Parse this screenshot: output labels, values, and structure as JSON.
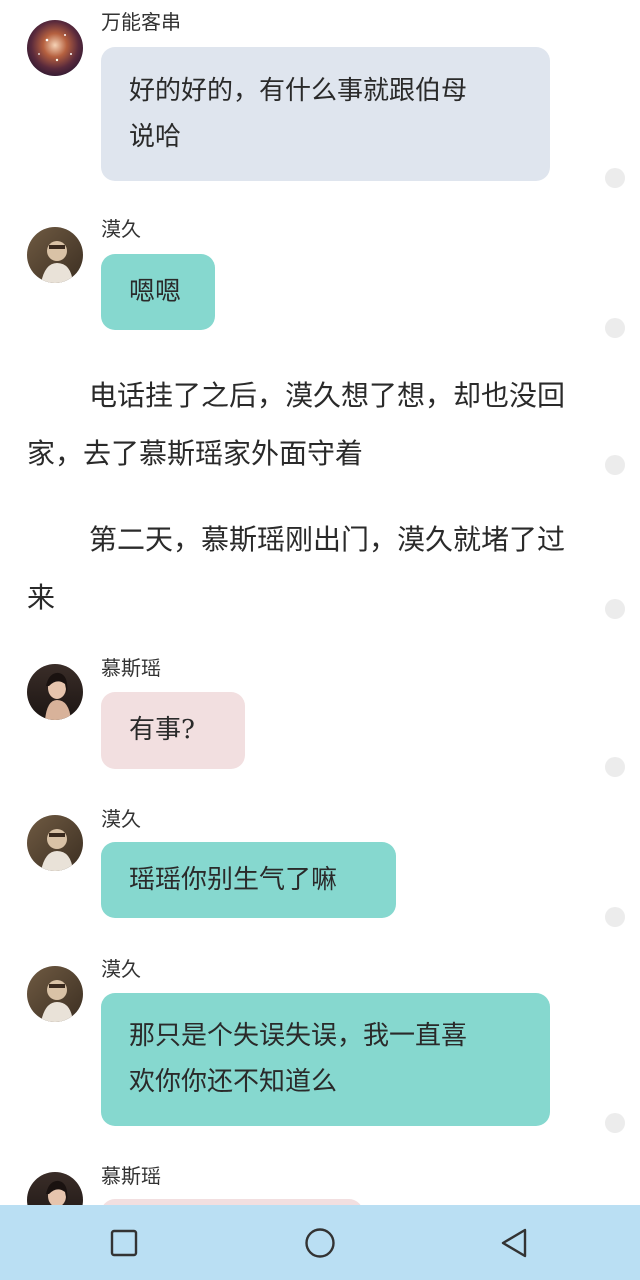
{
  "messages": [
    {
      "sender": "万能客串",
      "lines": [
        "好的好的，有什么事就跟伯母",
        "说哈"
      ],
      "bubble_color": "#dfe5ee",
      "avatar": "galaxy-avatar"
    },
    {
      "sender": "漠久",
      "lines": [
        "嗯嗯"
      ],
      "bubble_color": "#86d8cf",
      "avatar": "man-avatar"
    },
    {
      "sender": "慕斯瑶",
      "lines": [
        "有事?"
      ],
      "bubble_color": "#f2dfe0",
      "avatar": "woman-avatar"
    },
    {
      "sender": "漠久",
      "lines": [
        "瑶瑶你别生气了嘛"
      ],
      "bubble_color": "#86d8cf",
      "avatar": "man-avatar"
    },
    {
      "sender": "漠久",
      "lines": [
        "那只是个失误失误，我一直喜",
        "欢你你还不知道么"
      ],
      "bubble_color": "#86d8cf",
      "avatar": "man-avatar"
    },
    {
      "sender": "慕斯瑶",
      "lines": [],
      "bubble_color": "#f2dfe0",
      "avatar": "woman-avatar"
    }
  ],
  "narration": [
    "电话挂了之后，漠久想了想，却也没回家，去了慕斯瑶家外面守着",
    "第二天，慕斯瑶刚出门，漠久就堵了过来"
  ],
  "navbar": {
    "buttons": [
      "recent-apps",
      "home",
      "back"
    ],
    "background": "#badff3"
  }
}
